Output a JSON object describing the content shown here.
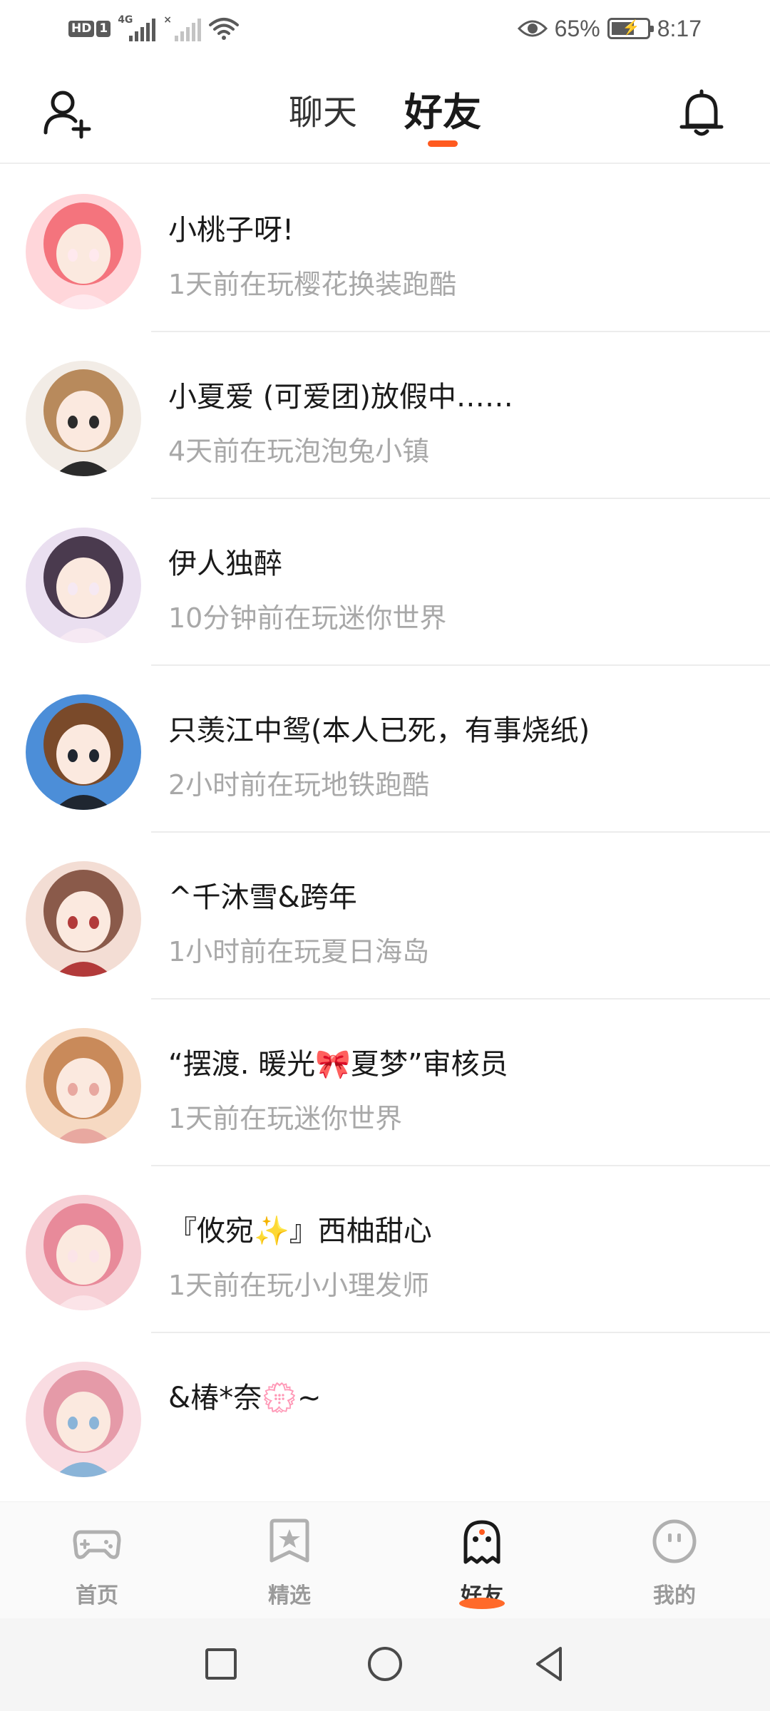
{
  "status_bar": {
    "hd": "HD",
    "sim": "1",
    "network": "4G",
    "network2": "×",
    "battery_percent": "65%",
    "battery_level": 0.65,
    "time": "8:17"
  },
  "header": {
    "tabs": [
      {
        "label": "聊天",
        "active": false
      },
      {
        "label": "好友",
        "active": true
      }
    ]
  },
  "friends": [
    {
      "name": "小桃子呀!",
      "activity": "1天前在玩樱花换装跑酷",
      "avatar_colors": [
        "#ffd6da",
        "#f4747d",
        "#ffe9ee"
      ]
    },
    {
      "name": "小夏爱 (可爱团)放假中……",
      "activity": "4天前在玩泡泡兔小镇",
      "avatar_colors": [
        "#f2ece6",
        "#b88a5c",
        "#2b2b2b"
      ]
    },
    {
      "name": "伊人独醉",
      "activity": "10分钟前在玩迷你世界",
      "avatar_colors": [
        "#eadff0",
        "#4a3a4e",
        "#f6e9f3"
      ]
    },
    {
      "name": "只羡江中鸳(本人已死，有事烧纸)",
      "activity": "2小时前在玩地铁跑酷",
      "avatar_colors": [
        "#4c8ed8",
        "#7a4a2a",
        "#1f2630"
      ]
    },
    {
      "name": "^千沐雪&跨年",
      "activity": "1小时前在玩夏日海岛",
      "avatar_colors": [
        "#f3ddd4",
        "#8a5a4a",
        "#b23a3a"
      ]
    },
    {
      "name": "“摆渡. 暖光🎀夏梦”审核员",
      "activity": "1天前在玩迷你世界",
      "avatar_colors": [
        "#f6d9c2",
        "#c98a5a",
        "#e8a8a0"
      ]
    },
    {
      "name": "『攸宛✨』西柚甜心",
      "activity": "1天前在玩小小理发师",
      "avatar_colors": [
        "#f7d0d6",
        "#e88a9a",
        "#fbe4e8"
      ]
    },
    {
      "name": "&椿*奈💮~",
      "activity": "",
      "avatar_colors": [
        "#f9dce2",
        "#e59aa8",
        "#8ab4d8"
      ]
    }
  ],
  "bottom_nav": [
    {
      "label": "首页",
      "icon": "gamepad-icon",
      "active": false
    },
    {
      "label": "精选",
      "icon": "star-bookmark-icon",
      "active": false
    },
    {
      "label": "好友",
      "icon": "ghost-icon",
      "active": true
    },
    {
      "label": "我的",
      "icon": "smiley-face-icon",
      "active": false
    }
  ],
  "colors": {
    "accent": "#ff5a1f",
    "text_primary": "#1a1a1a",
    "text_secondary": "#a8a8a8",
    "divider": "#ececec"
  }
}
